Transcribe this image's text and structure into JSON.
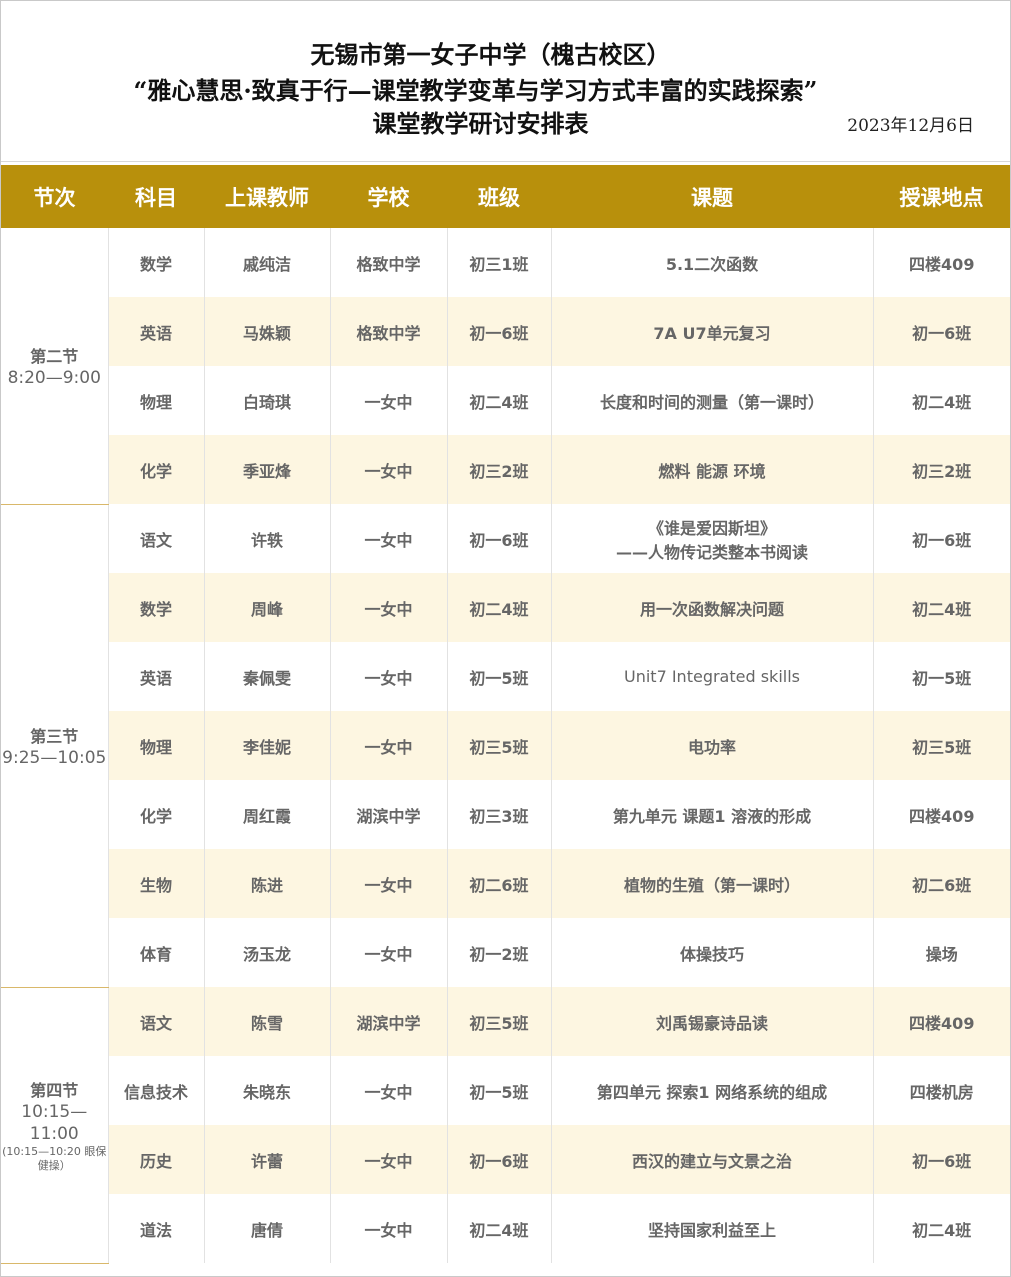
{
  "title": {
    "line1": "无锡市第一女子中学（槐古校区）",
    "line2": "“雅心慧思·致真于行—课堂教学变革与学习方式丰富的实践探索”",
    "line3": "课堂教学研讨安排表",
    "date": "2023年12月6日"
  },
  "columns": [
    "节次",
    "科目",
    "上课教师",
    "学校",
    "班级",
    "课题",
    "授课地点"
  ],
  "periods": [
    {
      "name": "第二节",
      "time": "8:20—9:00",
      "note": ""
    },
    {
      "name": "第三节",
      "time": "9:25—10:05",
      "note": ""
    },
    {
      "name": "第四节",
      "time": "10:15—11:00",
      "note": "(10:15—10:20 眼保健操）"
    }
  ],
  "rows": [
    {
      "subject": "数学",
      "teacher": "戚纯洁",
      "school": "格致中学",
      "class": "初三1班",
      "topic": "5.1二次函数",
      "topic2": "",
      "room": "四楼409"
    },
    {
      "subject": "英语",
      "teacher": "马姝颖",
      "school": "格致中学",
      "class": "初一6班",
      "topic": "7A  U7单元复习",
      "topic2": "",
      "room": "初一6班"
    },
    {
      "subject": "物理",
      "teacher": "白琦琪",
      "school": "一女中",
      "class": "初二4班",
      "topic": "长度和时间的测量（第一课时）",
      "topic2": "",
      "room": "初二4班"
    },
    {
      "subject": "化学",
      "teacher": "季亚烽",
      "school": "一女中",
      "class": "初三2班",
      "topic": "燃料 能源  环境",
      "topic2": "",
      "room": "初三2班"
    },
    {
      "subject": "语文",
      "teacher": "许轶",
      "school": "一女中",
      "class": "初一6班",
      "topic": "《谁是爱因斯坦》",
      "topic2": "——人物传记类整本书阅读",
      "room": "初一6班"
    },
    {
      "subject": "数学",
      "teacher": "周峰",
      "school": "一女中",
      "class": "初二4班",
      "topic": "用一次函数解决问题",
      "topic2": "",
      "room": "初二4班"
    },
    {
      "subject": "英语",
      "teacher": "秦佩雯",
      "school": "一女中",
      "class": "初一5班",
      "topic": "Unit7    Integrated    skills",
      "topic2": "",
      "room": "初一5班"
    },
    {
      "subject": "物理",
      "teacher": "李佳妮",
      "school": "一女中",
      "class": "初三5班",
      "topic": "电功率",
      "topic2": "",
      "room": "初三5班"
    },
    {
      "subject": "化学",
      "teacher": "周红霞",
      "school": "湖滨中学",
      "class": "初三3班",
      "topic": "第九单元 课题1 溶液的形成",
      "topic2": "",
      "room": "四楼409"
    },
    {
      "subject": "生物",
      "teacher": "陈进",
      "school": "一女中",
      "class": "初二6班",
      "topic": "植物的生殖（第一课时）",
      "topic2": "",
      "room": "初二6班"
    },
    {
      "subject": "体育",
      "teacher": "汤玉龙",
      "school": "一女中",
      "class": "初一2班",
      "topic": "体操技巧",
      "topic2": "",
      "room": "操场"
    },
    {
      "subject": "语文",
      "teacher": "陈雪",
      "school": "湖滨中学",
      "class": "初三5班",
      "topic": "刘禹锡豪诗品读",
      "topic2": "",
      "room": "四楼409"
    },
    {
      "subject": "信息技术",
      "teacher": "朱晓东",
      "school": "一女中",
      "class": "初一5班",
      "topic": "第四单元 探索1 网络系统的组成",
      "topic2": "",
      "room": "四楼机房"
    },
    {
      "subject": "历史",
      "teacher": "许蕾",
      "school": "一女中",
      "class": "初一6班",
      "topic": "西汉的建立与文景之治",
      "topic2": "",
      "room": "初一6班"
    },
    {
      "subject": "道法",
      "teacher": "唐倩",
      "school": "一女中",
      "class": "初二4班",
      "topic": "坚持国家利益至上",
      "topic2": "",
      "room": "初二4班"
    }
  ]
}
